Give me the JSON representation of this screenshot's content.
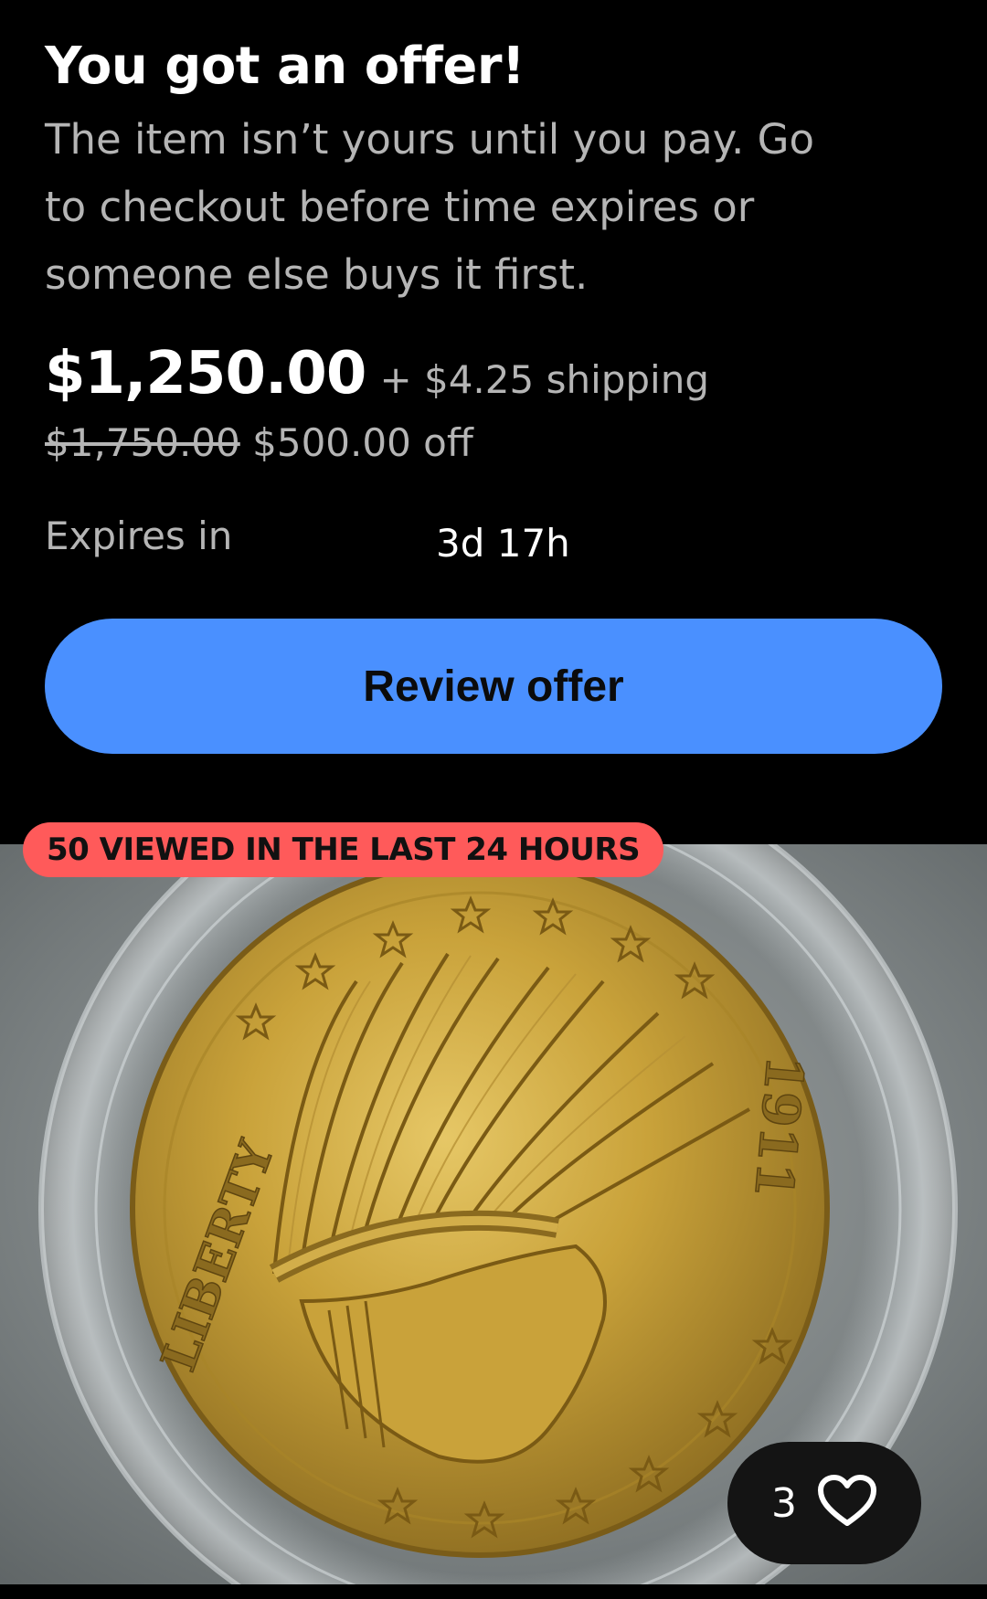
{
  "offer": {
    "title": "You got an offer!",
    "subtitle": "The item isn’t yours until you pay. Go to checkout before time expires or someone else buys it first.",
    "price": "$1,250.00",
    "shipping": "+ $4.25 shipping",
    "original_price": "$1,750.00",
    "discount": "$500.00 off",
    "expires_label": "Expires in",
    "expires_value": "3d 17h",
    "review_button_label": "Review offer"
  },
  "listing": {
    "views_badge": "50 VIEWED IN THE LAST 24 HOURS",
    "watch_count": "3",
    "watch_icon": "heart-icon",
    "image_inscriptions": [
      "LIBERTY",
      "1911"
    ]
  },
  "colors": {
    "background": "#000000",
    "button": "#4a90ff",
    "badge": "#ff5a5a",
    "coin_gold": "#c9a23a"
  }
}
